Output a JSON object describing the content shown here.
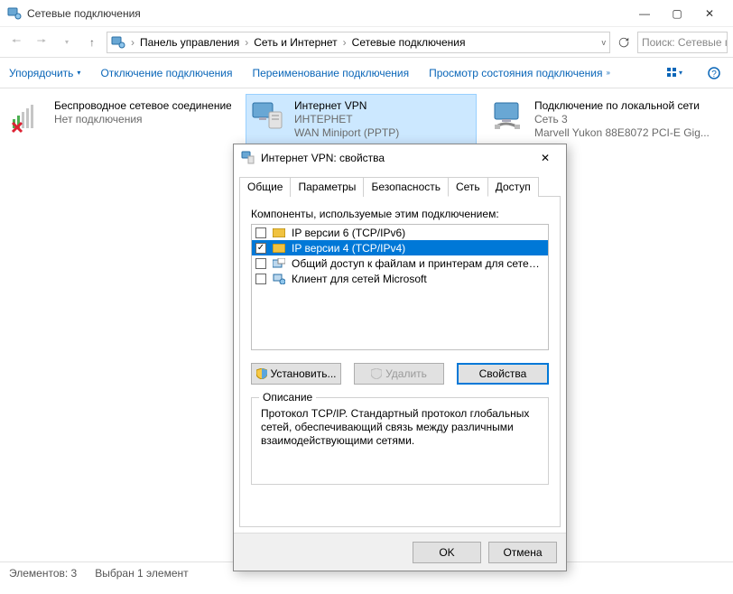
{
  "window": {
    "title": "Сетевые подключения"
  },
  "nav": {
    "crumb1": "Панель управления",
    "crumb2": "Сеть и Интернет",
    "crumb3": "Сетевые подключения",
    "search_placeholder": "Поиск: Сетевые п"
  },
  "cmd": {
    "organize": "Упорядочить",
    "disable": "Отключение подключения",
    "rename": "Переименование подключения",
    "status": "Просмотр состояния подключения"
  },
  "conns": {
    "c0": {
      "l1": "Беспроводное сетевое соединение",
      "l2": "Нет подключения"
    },
    "c1": {
      "l1": "Интернет  VPN",
      "l2": "ИНТЕРНЕТ",
      "l3": "WAN Miniport (PPTP)"
    },
    "c2": {
      "l1": "Подключение по локальной сети",
      "l2": "Сеть 3",
      "l3": "Marvell Yukon 88E8072 PCI-E Gig..."
    }
  },
  "status": {
    "items": "Элементов: 3",
    "selected": "Выбран 1 элемент"
  },
  "dlg": {
    "title": "Интернет VPN: свойства",
    "tabs": {
      "general": "Общие",
      "params": "Параметры",
      "security": "Безопасность",
      "net": "Сеть",
      "access": "Доступ"
    },
    "list_label": "Компоненты, используемые этим подключением:",
    "items": {
      "ipv6": "IP версии 6 (TCP/IPv6)",
      "ipv4": "IP версии 4 (TCP/IPv4)",
      "share": "Общий доступ к файлам и принтерам для сетей Micr...",
      "client": "Клиент для сетей Microsoft"
    },
    "btn_install": "Установить...",
    "btn_remove": "Удалить",
    "btn_props": "Свойства",
    "group_legend": "Описание",
    "desc": "Протокол TCP/IP. Стандартный протокол глобальных сетей, обеспечивающий связь между различными взаимодействующими сетями.",
    "ok": "OK",
    "cancel": "Отмена"
  }
}
